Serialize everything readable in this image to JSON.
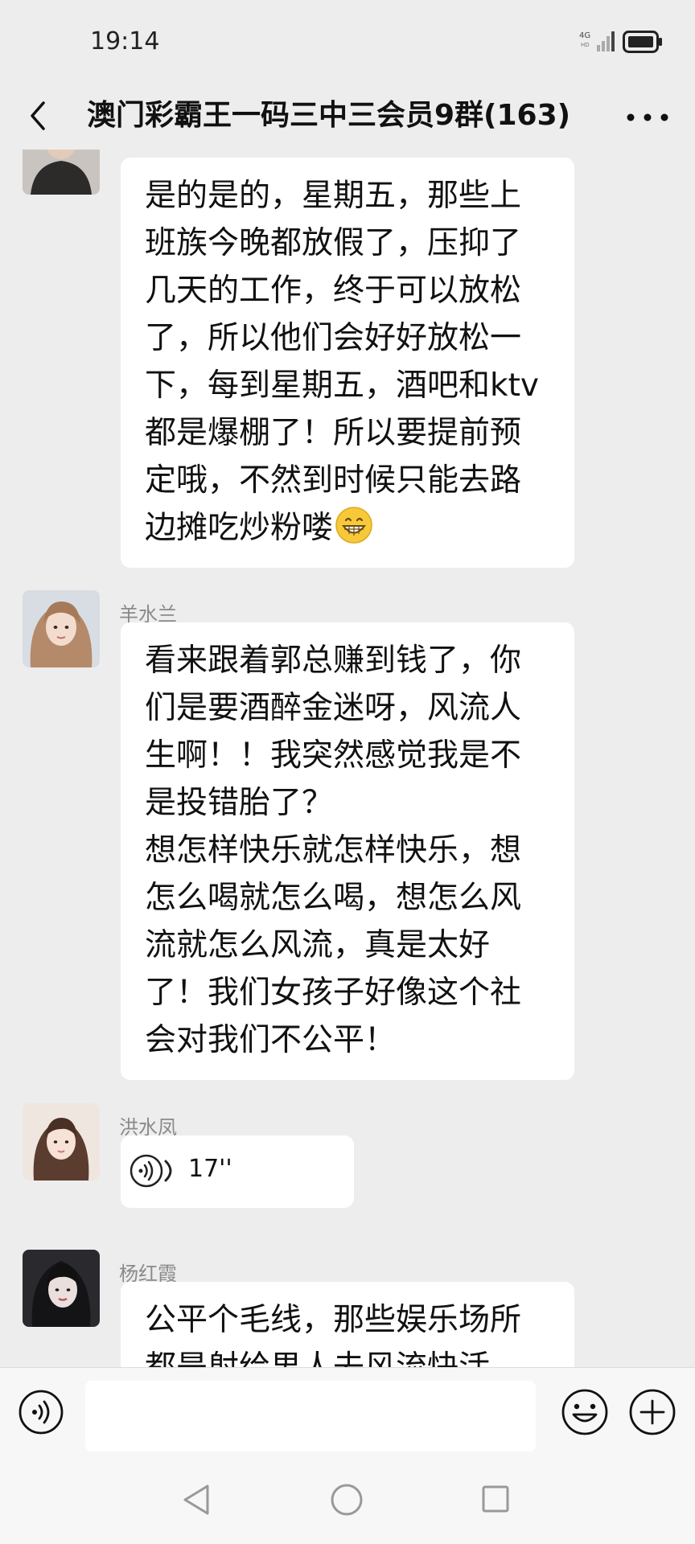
{
  "status_bar": {
    "time": "19:14",
    "network": "4G",
    "network_sub": "HD"
  },
  "header": {
    "title": "澳门彩霸王一码三中三会员9群(163)",
    "back_icon": "chevron-left-icon",
    "more_icon": "more-dots-icon"
  },
  "messages": [
    {
      "sender": "",
      "type": "text",
      "text": "是的是的，星期五，那些上班族今晚都放假了，压抑了几天的工作，终于可以放松了，所以他们会好好放松一下，每到星期五，酒吧和ktv都是爆棚了！所以要提前预定哦，不然到时候只能去路边摊吃炒粉喽",
      "trailing_emoji": "grin-emoji"
    },
    {
      "sender": "羊水兰",
      "type": "text",
      "text": "看来跟着郭总赚到钱了，你们是要酒醉金迷呀，风流人生啊！！我突然感觉我是不是投错胎了？\n想怎样快乐就怎样快乐，想怎么喝就怎么喝，想怎么风流就怎么风流，真是太好了！我们女孩子好像这个社会对我们不公平！"
    },
    {
      "sender": "洪水凤",
      "type": "voice",
      "duration": "17''"
    },
    {
      "sender": "杨红霞",
      "type": "text",
      "text": "公平个毛线，那些娱乐场所都是射给男人去风流快活"
    }
  ],
  "input_bar": {
    "voice_icon": "voice-mode-icon",
    "emoji_icon": "smiley-icon",
    "plus_icon": "plus-circle-icon"
  },
  "nav_bar": {
    "back_icon": "nav-back-icon",
    "home_icon": "nav-home-icon",
    "recent_icon": "nav-recent-icon"
  },
  "colors": {
    "background": "#ededed",
    "bubble": "#ffffff",
    "sender_name": "#8a8a8a"
  }
}
